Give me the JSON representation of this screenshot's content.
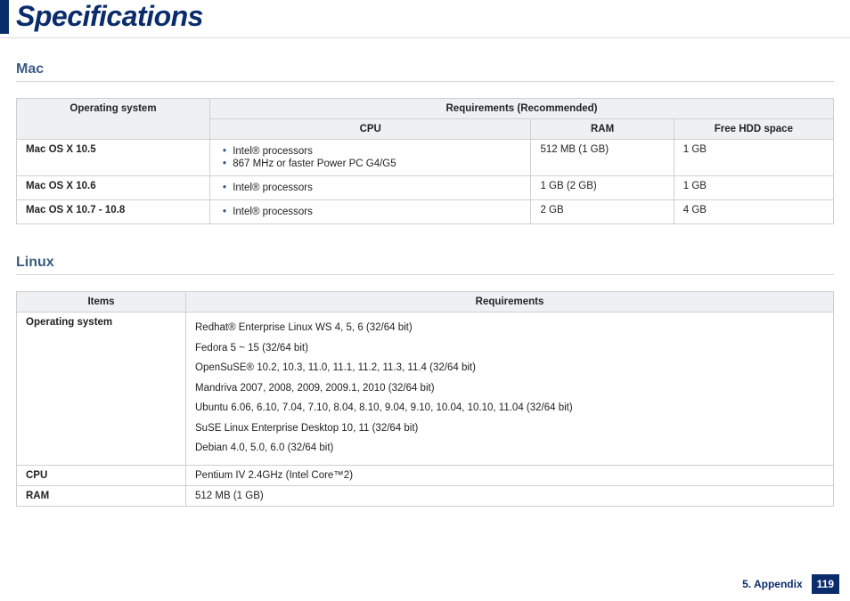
{
  "title": "Specifications",
  "sections": {
    "mac": {
      "heading": "Mac",
      "headers": {
        "os": "Operating system",
        "req": "Requirements (Recommended)",
        "cpu": "CPU",
        "ram": "RAM",
        "hdd": "Free HDD space"
      },
      "rows": [
        {
          "os": "Mac OS X 10.5",
          "cpu": [
            "Intel® processors",
            "867 MHz or faster Power PC G4/G5"
          ],
          "ram": "512 MB (1 GB)",
          "hdd": "1 GB"
        },
        {
          "os": "Mac OS X 10.6",
          "cpu": [
            "Intel® processors"
          ],
          "ram": "1 GB (2 GB)",
          "hdd": "1 GB"
        },
        {
          "os": "Mac OS X 10.7 - 10.8",
          "cpu": [
            "Intel® processors"
          ],
          "ram": "2 GB",
          "hdd": "4 GB"
        }
      ]
    },
    "linux": {
      "heading": "Linux",
      "headers": {
        "items": "Items",
        "req": "Requirements"
      },
      "rows": [
        {
          "item": "Operating system",
          "req_lines": [
            "Redhat® Enterprise Linux WS 4, 5, 6 (32/64 bit)",
            "Fedora 5 ~ 15 (32/64 bit)",
            "OpenSuSE® 10.2, 10.3, 11.0, 11.1, 11.2, 11.3, 11.4 (32/64 bit)",
            "Mandriva 2007, 2008, 2009, 2009.1, 2010 (32/64 bit)",
            "Ubuntu 6.06, 6.10, 7.04, 7.10, 8.04, 8.10, 9.04, 9.10, 10.04, 10.10, 11.04 (32/64 bit)",
            "SuSE Linux Enterprise Desktop 10, 11 (32/64 bit)",
            "Debian 4.0, 5.0, 6.0 (32/64 bit)"
          ]
        },
        {
          "item": "CPU",
          "req": "Pentium IV 2.4GHz (Intel Core™2)"
        },
        {
          "item": "RAM",
          "req": "512 MB (1 GB)"
        }
      ]
    }
  },
  "footer": {
    "section": "5. Appendix",
    "page": "119"
  }
}
